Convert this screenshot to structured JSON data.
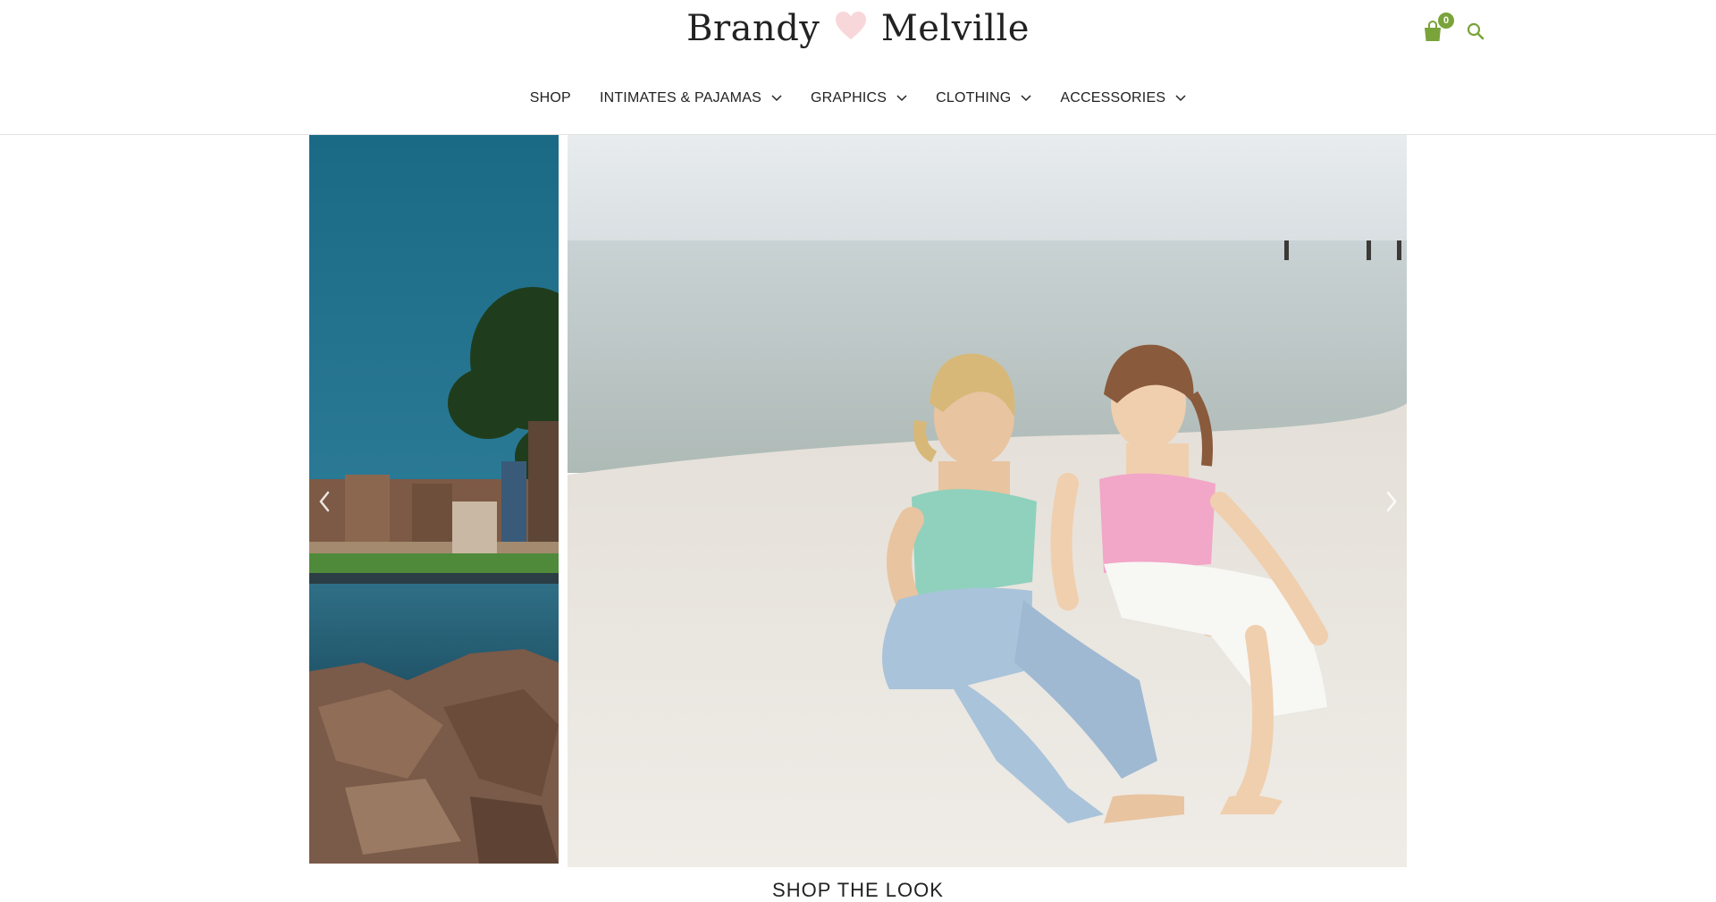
{
  "brand": {
    "word1": "Brandy",
    "word2": "Melville",
    "heart_color": "#f8d7da"
  },
  "cart": {
    "count": "0",
    "accent": "#7aa33a",
    "icon": "shopping-bag-icon"
  },
  "search": {
    "icon": "search-icon"
  },
  "nav": {
    "items": [
      {
        "label": "SHOP",
        "has_menu": false
      },
      {
        "label": "INTIMATES & PAJAMAS",
        "has_menu": true
      },
      {
        "label": "GRAPHICS",
        "has_menu": true
      },
      {
        "label": "CLOTHING",
        "has_menu": true
      },
      {
        "label": "ACCESSORIES",
        "has_menu": true
      }
    ]
  },
  "carousel": {
    "prev_icon": "chevron-left-icon",
    "next_icon": "chevron-right-icon"
  },
  "section": {
    "heading": "SHOP THE LOOK"
  }
}
